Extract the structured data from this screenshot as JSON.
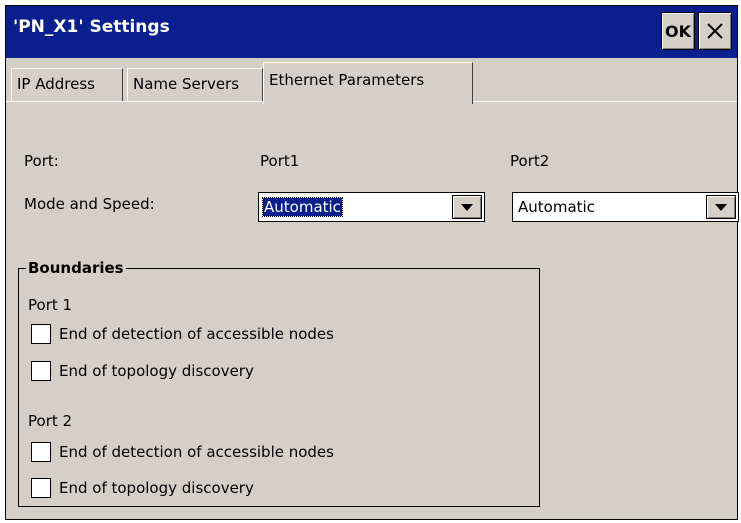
{
  "window": {
    "title": "'PN_X1' Settings",
    "ok_label": "OK"
  },
  "tabs": [
    "IP Address",
    "Name Servers",
    "Ethernet Parameters"
  ],
  "active_tab": "Ethernet Parameters",
  "form": {
    "port_label": "Port:",
    "port1_header": "Port1",
    "port2_header": "Port2",
    "mode_label": "Mode and Speed:",
    "port1_mode": "Automatic",
    "port2_mode": "Automatic"
  },
  "boundaries": {
    "title": "Boundaries",
    "port1": {
      "label": "Port 1",
      "detection": {
        "label": "End of detection of accessible nodes",
        "checked": false
      },
      "topology": {
        "label": "End of topology discovery",
        "checked": false
      }
    },
    "port2": {
      "label": "Port 2",
      "detection": {
        "label": "End of detection of accessible nodes",
        "checked": false
      },
      "topology": {
        "label": "End of topology discovery",
        "checked": false
      }
    }
  }
}
